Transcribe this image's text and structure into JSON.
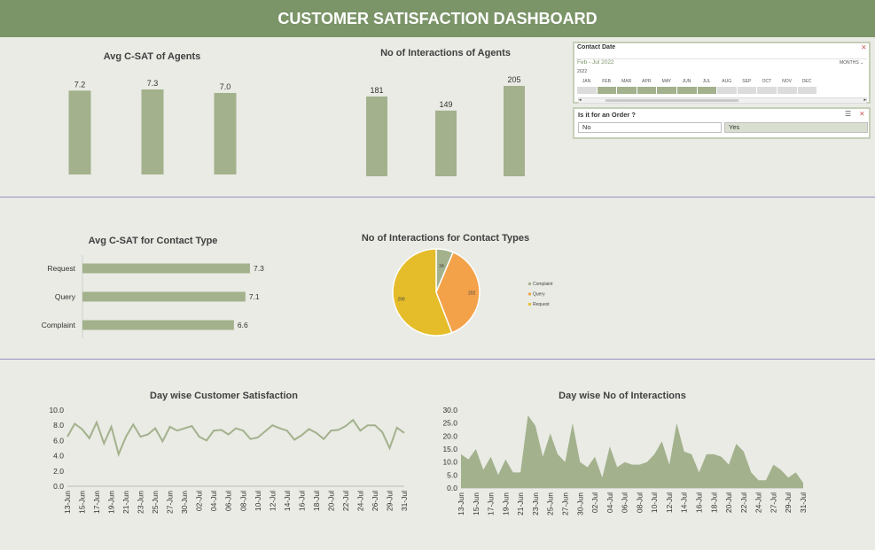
{
  "header": {
    "title": "CUSTOMER SATISFACTION DASHBOARD"
  },
  "colors": {
    "header": "#7b9468",
    "bar": "#a3b18d",
    "pie_complaint": "#a3b18d",
    "pie_query": "#f4a24a",
    "pie_request": "#e5bd2a",
    "line": "#a3b18d",
    "area": "#a3b18d"
  },
  "contact_date_slicer": {
    "title": "Contact Date",
    "range_label": "Feb - Jul 2022",
    "level": "MONTHS",
    "year": "2022",
    "months": [
      "JAN",
      "FEB",
      "MAR",
      "APR",
      "MAY",
      "JUN",
      "JUL",
      "AUG",
      "SEP",
      "OCT",
      "NOV",
      "DEC"
    ],
    "selected_from": "FEB",
    "selected_to": "JUL",
    "clear_icon": "clear-filter-icon"
  },
  "order_slicer": {
    "title": "Is it for an Order ?",
    "options": [
      {
        "label": "No",
        "selected": false
      },
      {
        "label": "Yes",
        "selected": true
      }
    ],
    "multiselect_icon": "multi-select-icon",
    "clear_icon": "clear-filter-icon"
  },
  "chart_data": [
    {
      "id": "agent-csat",
      "type": "bar",
      "title": "Avg C-SAT of Agents",
      "values": [
        7.2,
        7.3,
        7.0
      ],
      "labels": [
        "7.2",
        "7.3",
        "7.0"
      ]
    },
    {
      "id": "agent-interactions",
      "type": "bar",
      "title": "No of Interactions of Agents",
      "values": [
        181,
        149,
        205
      ],
      "labels": [
        "181",
        "149",
        "205"
      ]
    },
    {
      "id": "contact-type-csat",
      "type": "bar",
      "orientation": "horizontal",
      "title": "Avg C-SAT for Contact Type",
      "categories": [
        "Request",
        "Query",
        "Complaint"
      ],
      "values": [
        7.3,
        7.1,
        6.6
      ],
      "labels": [
        "7.3",
        "7.1",
        "6.6"
      ]
    },
    {
      "id": "contact-type-interactions",
      "type": "pie",
      "title": "No of Interactions for Contact Types",
      "slices": [
        {
          "name": "Complaint",
          "value": 34
        },
        {
          "name": "Query",
          "value": 202
        },
        {
          "name": "Request",
          "value": 299
        }
      ],
      "legend": [
        "Complaint",
        "Query",
        "Request"
      ],
      "legend_position": "right"
    },
    {
      "id": "daywise-csat",
      "type": "line",
      "title": "Day wise Customer Satisfaction",
      "ylim": [
        0,
        10
      ],
      "yticks": [
        "0.0",
        "2.0",
        "4.0",
        "6.0",
        "8.0",
        "10.0"
      ],
      "xticks": [
        "13-Jun",
        "15-Jun",
        "17-Jun",
        "19-Jun",
        "21-Jun",
        "23-Jun",
        "25-Jun",
        "27-Jun",
        "30-Jun",
        "02-Jul",
        "04-Jul",
        "06-Jul",
        "08-Jul",
        "10-Jul",
        "12-Jul",
        "14-Jul",
        "16-Jul",
        "18-Jul",
        "20-Jul",
        "22-Jul",
        "24-Jul",
        "26-Jul",
        "29-Jul",
        "31-Jul"
      ],
      "values": [
        6.5,
        8.2,
        7.5,
        6.3,
        8.4,
        5.6,
        7.8,
        4.2,
        6.5,
        8.1,
        6.5,
        6.8,
        7.6,
        5.9,
        7.8,
        7.3,
        7.6,
        7.9,
        6.5,
        6.0,
        7.3,
        7.4,
        6.8,
        7.6,
        7.3,
        6.2,
        6.4,
        7.2,
        8.0,
        7.6,
        7.3,
        6.1,
        6.7,
        7.5,
        7.0,
        6.2,
        7.3,
        7.4,
        7.9,
        8.7,
        7.3,
        8.0,
        8.0,
        7.1,
        5.0,
        7.7,
        7.0
      ]
    },
    {
      "id": "daywise-interactions",
      "type": "area",
      "title": "Day wise No of Interactions",
      "ylim": [
        0,
        30
      ],
      "yticks": [
        "0.0",
        "5.0",
        "10.0",
        "15.0",
        "20.0",
        "25.0",
        "30.0"
      ],
      "xticks": [
        "13-Jun",
        "15-Jun",
        "17-Jun",
        "19-Jun",
        "21-Jun",
        "23-Jun",
        "25-Jun",
        "27-Jun",
        "30-Jun",
        "02-Jul",
        "04-Jul",
        "06-Jul",
        "08-Jul",
        "10-Jul",
        "12-Jul",
        "14-Jul",
        "16-Jul",
        "18-Jul",
        "20-Jul",
        "22-Jul",
        "24-Jul",
        "27-Jul",
        "29-Jul",
        "31-Jul"
      ],
      "values": [
        13,
        11,
        15,
        7,
        12,
        5,
        11,
        6,
        6,
        28,
        24,
        12,
        21,
        13,
        10,
        25,
        10,
        8,
        12,
        4,
        16,
        8,
        10,
        9,
        9,
        10,
        13,
        18,
        9,
        25,
        14,
        13,
        6,
        13,
        13,
        12,
        9,
        17,
        14,
        6,
        3,
        3,
        9,
        7,
        4,
        6,
        2
      ]
    }
  ]
}
